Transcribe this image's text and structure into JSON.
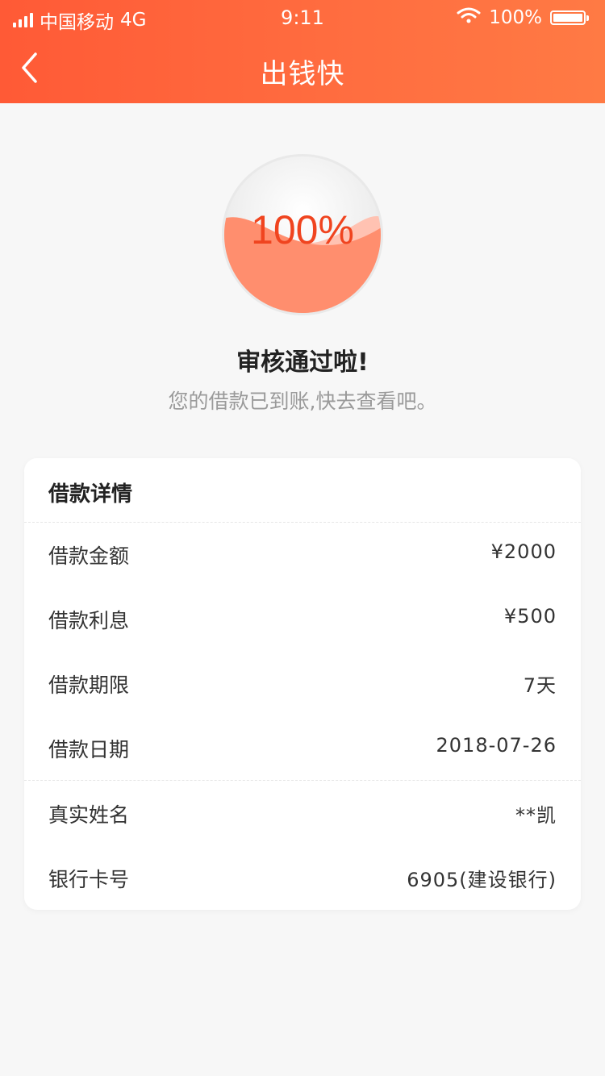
{
  "status_bar": {
    "carrier": "中国移动",
    "network": "4G",
    "time": "9:11",
    "battery_label": "100%",
    "battery_level": 1.0
  },
  "nav": {
    "title": "出钱快",
    "back_icon": "chevron-left-icon"
  },
  "progress": {
    "label": "100%",
    "value": 1.0,
    "color": "#ff8a6a"
  },
  "status": {
    "title": "审核通过啦!",
    "subtitle": "您的借款已到账,快去查看吧。"
  },
  "details": {
    "header": "借款详情",
    "loan_rows": [
      {
        "label": "借款金额",
        "value": "¥2000"
      },
      {
        "label": "借款利息",
        "value": "¥500"
      },
      {
        "label": "借款期限",
        "value": "7天"
      },
      {
        "label": "借款日期",
        "value": "2018-07-26"
      }
    ],
    "user_rows": [
      {
        "label": "真实姓名",
        "value": "**凯"
      },
      {
        "label": "银行卡号",
        "value": "6905(建设银行)"
      }
    ]
  },
  "colors": {
    "accent": "#ff5a36",
    "progress_text": "#f0441f"
  }
}
